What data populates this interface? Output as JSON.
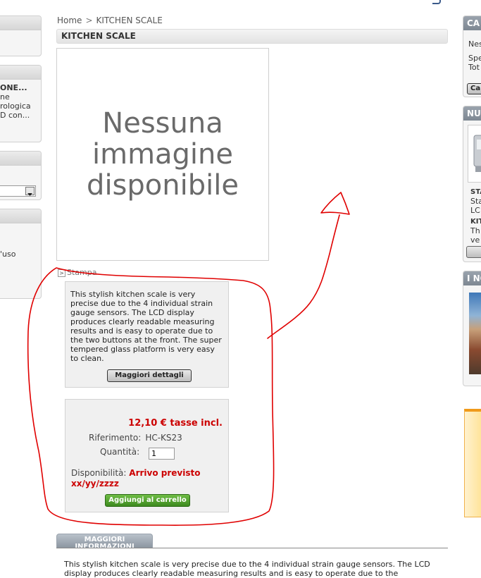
{
  "breadcrumb": {
    "home": "Home",
    "separator": ">",
    "current": "KITCHEN SCALE"
  },
  "product": {
    "title": "KITCHEN SCALE",
    "image_placeholder": "Nessuna\nimmagine\ndisponibile",
    "print_label": "Stampa",
    "short_description": "This stylish kitchen scale is very precise due to the 4 individual strain gauge sensors. The LCD display produces clearly readable measuring results and is easy to operate due to the two buttons at the front. The super tempered glass platform is very easy to clean.",
    "more_details_label": "Maggiori dettagli",
    "price": "12,10 € tasse incl.",
    "reference_label": "Riferimento:",
    "reference_value": "HC-KS23",
    "quantity_label": "Quantità:",
    "quantity_value": "1",
    "availability_label": "Disponibilità:",
    "availability_value": "Arrivo previsto xx/yy/zzzz",
    "add_to_cart_label": "Aggiungi al carrello"
  },
  "tabs": {
    "more_info_label": "MAGGIORI INFORMAZIONI"
  },
  "long_description": "This stylish kitchen scale is very precise due to the 4 individual strain gauge sensors. The LCD display produces clearly readable measuring results and is easy to operate due to the",
  "left_column": {
    "box2_lines": [
      "ONE...",
      "ne",
      "rologica",
      "D con..."
    ],
    "box4_text": "'uso"
  },
  "right_column": {
    "cart_head": "CA",
    "cart_lines": [
      "Ness",
      "Spe",
      "Tot"
    ],
    "cart_button": "Ca",
    "new_head": "NU",
    "new_lines": [
      "STA",
      "Sta",
      "LC",
      "KIT",
      "Th",
      "ve"
    ],
    "box3_head": "I NO"
  },
  "colors": {
    "annotation": "#e00000",
    "price_red": "#cc0000",
    "cart_green": "#4a9a28"
  }
}
